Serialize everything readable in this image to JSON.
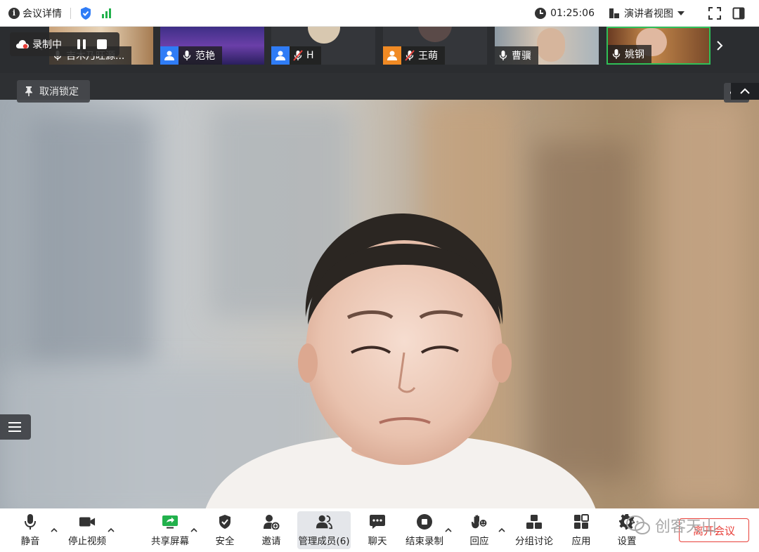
{
  "topbar": {
    "meeting_info_label": "会议详情",
    "timer": "01:25:06",
    "view_mode_label": "演讲者视图"
  },
  "recording": {
    "status_label": "录制中"
  },
  "thumbnails": [
    {
      "name": "吉木乃旺源...",
      "avatar": "none",
      "mic": "on"
    },
    {
      "name": "范艳",
      "avatar": "blue",
      "mic": "on"
    },
    {
      "name": "H",
      "avatar": "blue",
      "mic": "muted"
    },
    {
      "name": "王萌",
      "avatar": "orange",
      "mic": "muted"
    },
    {
      "name": "曹骥",
      "avatar": "none",
      "mic": "on"
    },
    {
      "name": "姚钢",
      "avatar": "none",
      "mic": "on",
      "active": true
    }
  ],
  "pinbar": {
    "unpin_label": "取消锁定"
  },
  "toolbar": {
    "mute_label": "静音",
    "stop_video_label": "停止视频",
    "share_screen_label": "共享屏幕",
    "security_label": "安全",
    "invite_label": "邀请",
    "manage_members_label": "管理成员(6)",
    "chat_label": "聊天",
    "end_recording_label": "结束录制",
    "reactions_label": "回应",
    "breakout_label": "分组讨论",
    "apps_label": "应用",
    "settings_label": "设置",
    "leave_label": "离开会议"
  },
  "watermark": {
    "text": "创客天山"
  },
  "colors": {
    "accent_blue": "#2f7cf6",
    "active_green": "#2fbf58",
    "signal_green": "#22b14c",
    "leave_red": "#e8403a"
  }
}
